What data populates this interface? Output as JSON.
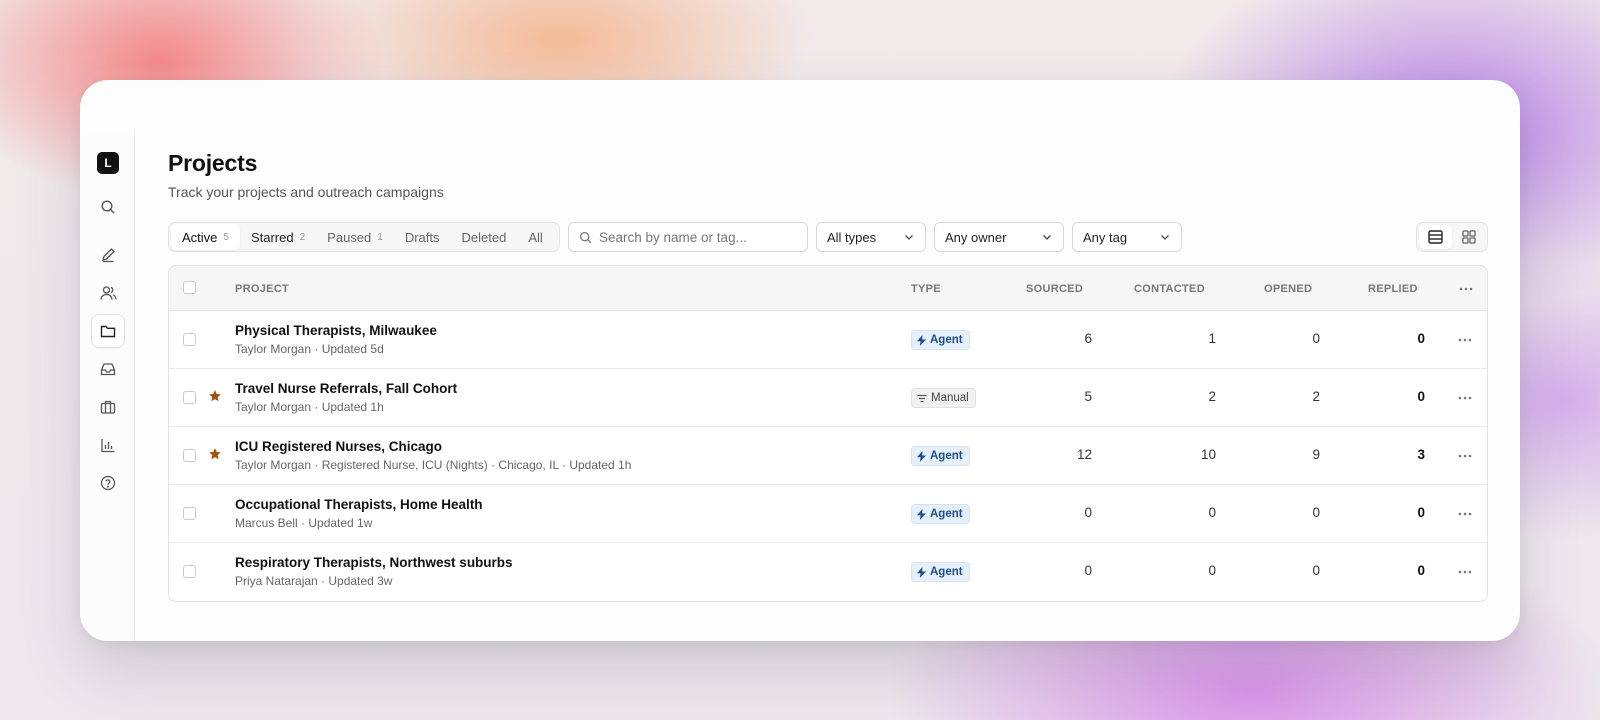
{
  "app": {
    "logo_letter": "L"
  },
  "sidebar": {
    "items": [
      {
        "name": "search",
        "icon": "search-icon"
      },
      {
        "name": "compose",
        "icon": "pencil-icon"
      },
      {
        "name": "people",
        "icon": "users-icon"
      },
      {
        "name": "projects",
        "icon": "folder-icon",
        "active": true
      },
      {
        "name": "inbox",
        "icon": "inbox-icon"
      },
      {
        "name": "jobs",
        "icon": "briefcase-icon"
      },
      {
        "name": "analytics",
        "icon": "bar-chart-icon"
      },
      {
        "name": "help",
        "icon": "help-circle-icon"
      }
    ]
  },
  "header": {
    "title": "Projects",
    "subtitle": "Track your projects and outreach campaigns"
  },
  "tabs": [
    {
      "label": "Active",
      "count": "5",
      "active": true
    },
    {
      "label": "Starred",
      "count": "2"
    },
    {
      "label": "Paused",
      "count": "1"
    },
    {
      "label": "Drafts",
      "count": ""
    },
    {
      "label": "Deleted",
      "count": ""
    },
    {
      "label": "All",
      "count": ""
    }
  ],
  "search": {
    "placeholder": "Search by name or tag...",
    "value": ""
  },
  "filters": {
    "type": "All types",
    "owner": "Any owner",
    "tag": "Any tag"
  },
  "table": {
    "columns": {
      "project": "PROJECT",
      "type": "TYPE",
      "sourced": "SOURCED",
      "contacted": "CONTACTED",
      "opened": "OPENED",
      "replied": "REPLIED"
    },
    "rows": [
      {
        "name": "Physical Therapists, Milwaukee",
        "meta": "Taylor Morgan · Updated 5d",
        "starred": false,
        "type": "Agent",
        "sourced": "6",
        "contacted": "1",
        "opened": "0",
        "replied": "0"
      },
      {
        "name": "Travel Nurse Referrals, Fall Cohort",
        "meta": "Taylor Morgan · Updated 1h",
        "starred": true,
        "type": "Manual",
        "sourced": "5",
        "contacted": "2",
        "opened": "2",
        "replied": "0"
      },
      {
        "name": "ICU Registered Nurses, Chicago",
        "meta": "Taylor Morgan · Registered Nurse, ICU (Nights) · Chicago, IL · Updated 1h",
        "starred": true,
        "type": "Agent",
        "sourced": "12",
        "contacted": "10",
        "opened": "9",
        "replied": "3"
      },
      {
        "name": "Occupational Therapists, Home Health",
        "meta": "Marcus Bell · Updated 1w",
        "starred": false,
        "type": "Agent",
        "sourced": "0",
        "contacted": "0",
        "opened": "0",
        "replied": "0"
      },
      {
        "name": "Respiratory Therapists, Northwest suburbs",
        "meta": "Priya Natarajan · Updated 3w",
        "starred": false,
        "type": "Agent",
        "sourced": "0",
        "contacted": "0",
        "opened": "0",
        "replied": "0"
      }
    ]
  },
  "colors": {
    "star": "#a0520e",
    "agent_badge_bg": "#e6f0fb",
    "agent_badge_text": "#1e4f8c"
  }
}
